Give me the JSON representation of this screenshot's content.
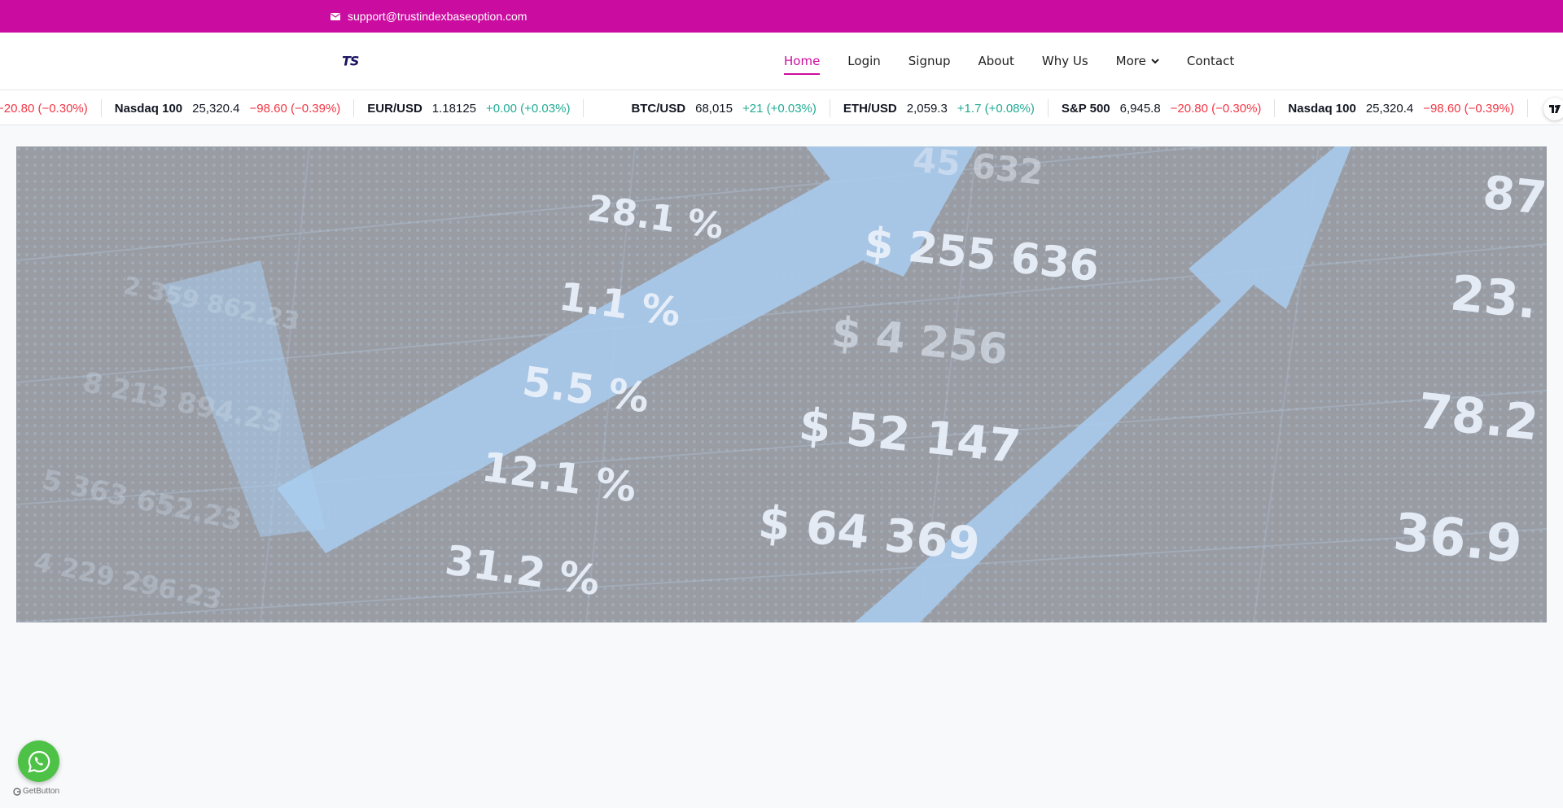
{
  "topbar": {
    "email": "support@trustindexbaseoption.com",
    "email_icon": "envelope-icon",
    "bg_color": "#cb0ca0"
  },
  "header": {
    "logo_text": "TS",
    "nav": [
      {
        "label": "Home",
        "active": true
      },
      {
        "label": "Login",
        "active": false
      },
      {
        "label": "Signup",
        "active": false
      },
      {
        "label": "About",
        "active": false
      },
      {
        "label": "Why Us",
        "active": false
      },
      {
        "label": "More",
        "active": false,
        "icon": "chevron-down-icon"
      },
      {
        "label": "Contact",
        "active": false
      }
    ],
    "accent_color": "#cb0ca0"
  },
  "ticker": {
    "leading_change": "−20.80 (−0.30%)",
    "items": [
      {
        "symbol": "Nasdaq 100",
        "price": "25,320.4",
        "change": "−98.60 (−0.39%)",
        "direction": "down"
      },
      {
        "symbol": "EUR/USD",
        "price": "1.18125",
        "change": "+0.00 (+0.03%)",
        "direction": "up"
      },
      {
        "symbol": "BTC/USD",
        "price": "68,015",
        "change": "+21 (+0.03%)",
        "direction": "up"
      },
      {
        "symbol": "ETH/USD",
        "price": "2,059.3",
        "change": "+1.7 (+0.08%)",
        "direction": "up"
      },
      {
        "symbol": "S&P 500",
        "price": "6,945.8",
        "change": "−20.80 (−0.30%)",
        "direction": "down"
      },
      {
        "symbol": "Nasdaq 100",
        "price": "25,320.4",
        "change": "−98.60 (−0.39%)",
        "direction": "down"
      }
    ],
    "badge_icon": "tradingview-logo-icon",
    "colors": {
      "down": "#f23645",
      "up": "#22ab94"
    }
  },
  "hero": {
    "numbers": [
      "28.1 %",
      "1.1 %",
      "5.5 %",
      "12.1 %",
      "31.2 %",
      "$ 255 636",
      "$ 4 256",
      "$ 52 147",
      "$ 64 369",
      "87",
      "23.",
      "78.2",
      "36.9",
      "45 632"
    ]
  },
  "whatsapp": {
    "icon": "whatsapp-icon",
    "credit": "GetButton",
    "color": "#4dc247"
  }
}
